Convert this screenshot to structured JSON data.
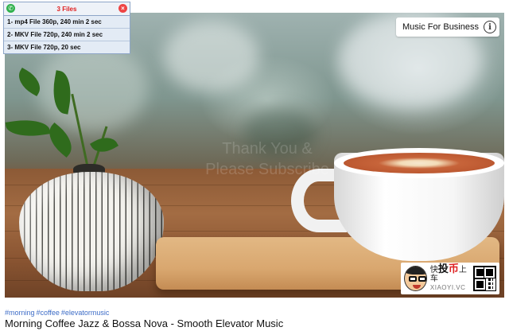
{
  "files_panel": {
    "title": "3 Files",
    "items": [
      "1- mp4 File 360p, 240 min 2 sec",
      "2- MKV File 720p, 240 min 2 sec",
      "3- MKV File 720p, 20 sec"
    ]
  },
  "player": {
    "music_for_business_label": "Music For Business",
    "info_icon": "i",
    "watermark_line1": "Thank You &",
    "watermark_line2": "Please Subscribe"
  },
  "sponsor": {
    "cn_prefix": "快",
    "cn_main_1": "投",
    "cn_main_2": "币",
    "cn_suffix": "上车",
    "en": "XIAOYI.VC"
  },
  "video": {
    "tags": [
      "#morning",
      "#coffee",
      "#elevatormusic"
    ],
    "title": "Morning Coffee Jazz & Bossa Nova - Smooth Elevator Music"
  },
  "colors": {
    "tag_link": "#3e6dc7",
    "files_title": "#e02020"
  }
}
